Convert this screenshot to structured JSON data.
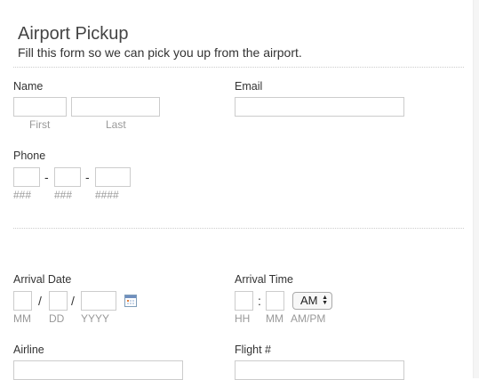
{
  "header": {
    "title": "Airport Pickup",
    "subtitle": "Fill this form so we can pick you up from the airport."
  },
  "name": {
    "label": "Name",
    "first_sub": "First",
    "last_sub": "Last",
    "first_value": "",
    "last_value": ""
  },
  "email": {
    "label": "Email",
    "value": ""
  },
  "phone": {
    "label": "Phone",
    "sep1": "-",
    "sep2": "-",
    "sub_area": "###",
    "sub_prefix": "###",
    "sub_line": "####"
  },
  "arrival_date": {
    "label": "Arrival Date",
    "sep1": "/",
    "sep2": "/",
    "sub_mm": "MM",
    "sub_dd": "DD",
    "sub_yyyy": "YYYY",
    "calendar_icon": "calendar-icon"
  },
  "arrival_time": {
    "label": "Arrival Time",
    "sep": ":",
    "ampm_value": "AM",
    "sub_hh": "HH",
    "sub_mm": "MM",
    "sub_ampm": "AM/PM"
  },
  "airline": {
    "label": "Airline",
    "value": ""
  },
  "flight": {
    "label": "Flight #",
    "value": ""
  }
}
